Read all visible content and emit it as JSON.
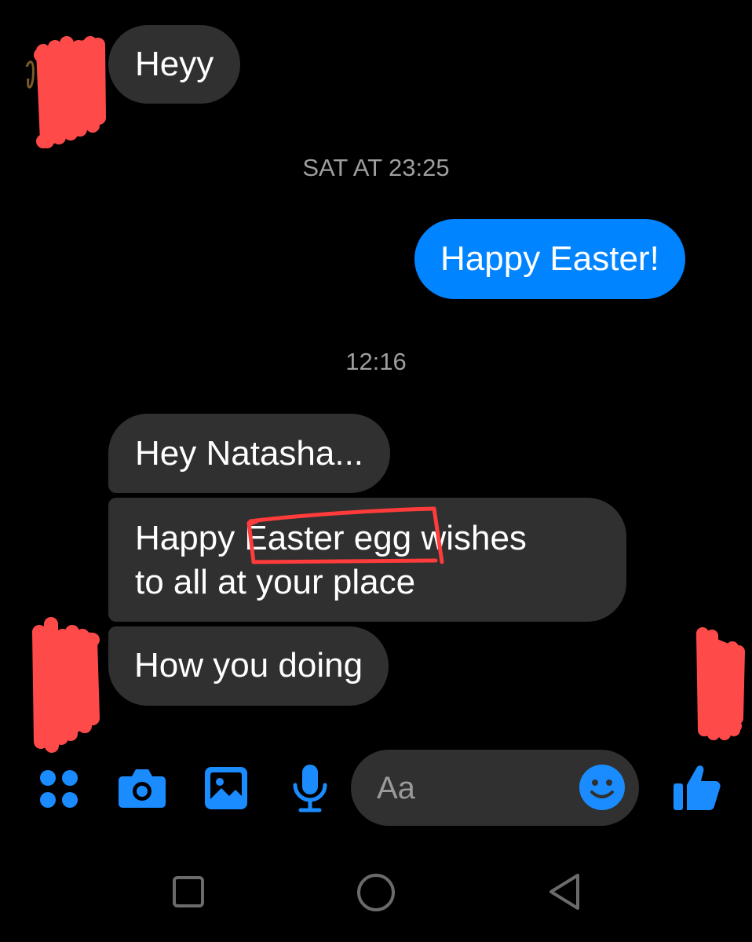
{
  "conversation": {
    "messages": [
      {
        "direction": "incoming",
        "text": "Heyy"
      },
      {
        "direction": "outgoing",
        "text": "Happy Easter!"
      },
      {
        "direction": "incoming",
        "text": "Hey Natasha..."
      },
      {
        "direction": "incoming",
        "text_line1": "Happy Easter egg wishes",
        "text_line2": "to all at your place"
      },
      {
        "direction": "incoming",
        "text": "How you doing"
      }
    ],
    "timestamps": [
      "SAT AT 23:25",
      "12:16"
    ]
  },
  "composer": {
    "placeholder": "Aa"
  },
  "icons": {
    "toolbar": [
      "apps-icon",
      "camera-icon",
      "gallery-icon",
      "microphone-icon",
      "emoji-icon",
      "thumbs-up-icon"
    ],
    "navigation": [
      "recents-icon",
      "home-icon",
      "back-icon"
    ]
  },
  "colors": {
    "background": "#000000",
    "incoming_bubble": "#303030",
    "outgoing_bubble": "#0084ff",
    "accent": "#1a8cff",
    "timestamp_text": "#9e9e9e",
    "redaction": "#ff4a4a"
  }
}
